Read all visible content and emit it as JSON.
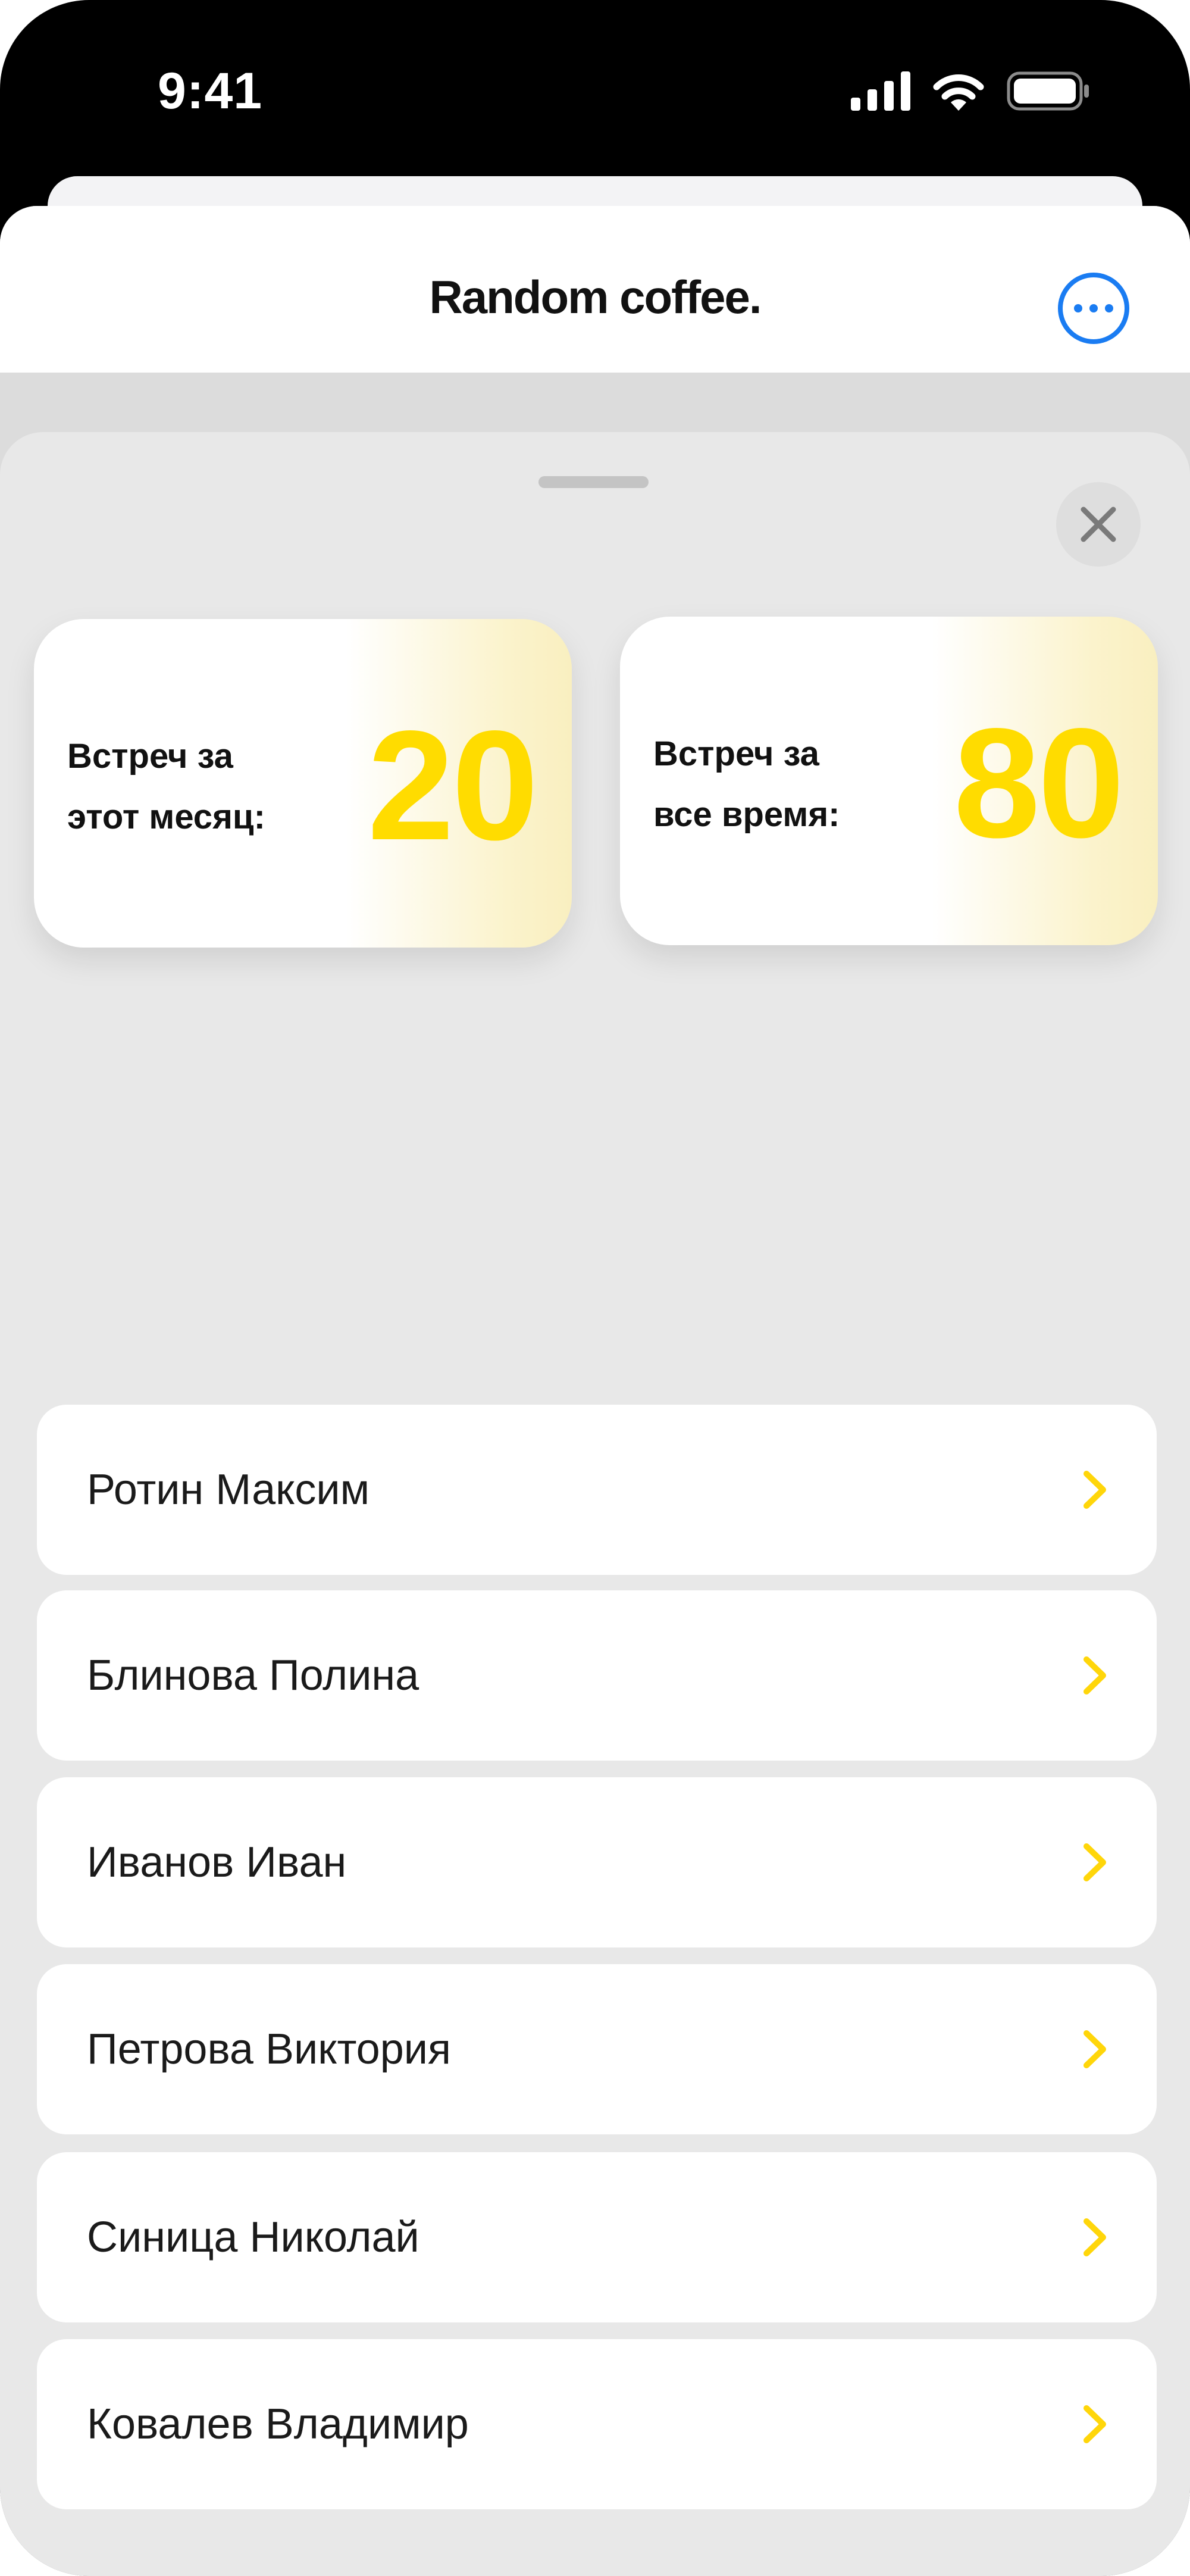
{
  "status_bar": {
    "time": "9:41",
    "icons": [
      "cellular-signal-icon",
      "wifi-icon",
      "battery-icon"
    ]
  },
  "nav": {
    "title": "Random coffee.",
    "more_icon": "ellipsis-circle-icon"
  },
  "modal": {
    "close_icon": "close-x-icon",
    "stats": [
      {
        "label_line1": "Встреч за",
        "label_line2": "этот месяц:",
        "value": "20"
      },
      {
        "label_line1": "Встреч за",
        "label_line2": "все время:",
        "value": "80"
      }
    ],
    "people": [
      {
        "name": "Ротин Максим"
      },
      {
        "name": "Блинова Полина"
      },
      {
        "name": "Иванов Иван"
      },
      {
        "name": "Петрова Виктория"
      },
      {
        "name": "Синица Николай"
      },
      {
        "name": "Ковалев Владимир"
      }
    ]
  },
  "colors": {
    "accent_yellow": "#ffdc00",
    "link_blue": "#1a7cf2",
    "sheet_background": "#e8e8e8",
    "card_background": "#ffffff"
  }
}
